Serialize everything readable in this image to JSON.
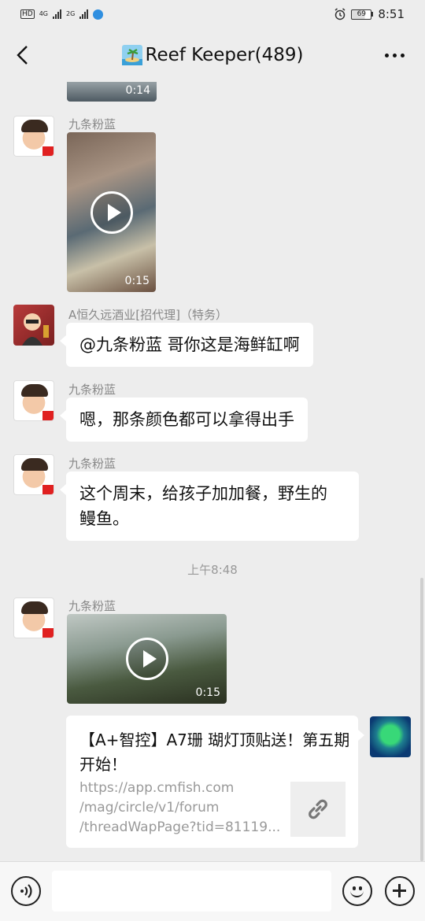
{
  "status_bar": {
    "hd_label": "HD",
    "net1": "4G",
    "net2": "2G",
    "battery": "69",
    "time": "8:51"
  },
  "header": {
    "title": "Reef Keeper(489)",
    "title_icon": "island-icon"
  },
  "messages": [
    {
      "type": "video",
      "duration": "0:14"
    },
    {
      "type": "video",
      "sender": "九条粉蓝",
      "duration": "0:15"
    },
    {
      "type": "text",
      "sender": "A恒久远酒业[招代理]（特务）",
      "text": "@九条粉蓝  哥你这是海鲜缸啊"
    },
    {
      "type": "text",
      "sender": "九条粉蓝",
      "text": "嗯，那条颜色都可以拿得出手"
    },
    {
      "type": "text",
      "sender": "九条粉蓝",
      "text_line1": "这个周末，给孩子加加餐，野生的",
      "text_line2": "鳗鱼。"
    },
    {
      "type": "time",
      "text": "上午8:48"
    },
    {
      "type": "video",
      "sender": "九条粉蓝",
      "duration": "0:15"
    },
    {
      "type": "link",
      "title": "【A+智控】A7珊 瑚灯顶贴送！第五期开始！",
      "url_line1": "https://app.cmfish.com",
      "url_line2": "/mag/circle/v1/forum",
      "url_line3": "/threadWapPage?tid=81119..."
    }
  ]
}
